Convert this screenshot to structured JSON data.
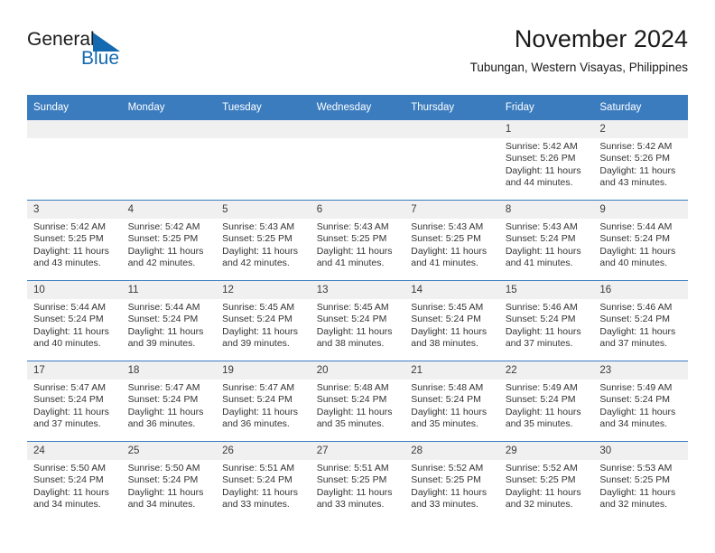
{
  "brand": {
    "name_part1": "General",
    "name_part2": "Blue",
    "triangle_color": "#1569b0"
  },
  "header": {
    "month_title": "November 2024",
    "location": "Tubungan, Western Visayas, Philippines"
  },
  "theme": {
    "header_blue": "#3b7cbf",
    "daynum_band": "#f0f0f0",
    "text": "#333333"
  },
  "columns": [
    "Sunday",
    "Monday",
    "Tuesday",
    "Wednesday",
    "Thursday",
    "Friday",
    "Saturday"
  ],
  "labels": {
    "sunrise_prefix": "Sunrise:",
    "sunset_prefix": "Sunset:",
    "daylight_prefix": "Daylight:"
  },
  "weeks": [
    [
      {
        "day": "",
        "empty": true
      },
      {
        "day": "",
        "empty": true
      },
      {
        "day": "",
        "empty": true
      },
      {
        "day": "",
        "empty": true
      },
      {
        "day": "",
        "empty": true
      },
      {
        "day": "1",
        "sunrise": "Sunrise: 5:42 AM",
        "sunset": "Sunset: 5:26 PM",
        "daylight": "Daylight: 11 hours and 44 minutes."
      },
      {
        "day": "2",
        "sunrise": "Sunrise: 5:42 AM",
        "sunset": "Sunset: 5:26 PM",
        "daylight": "Daylight: 11 hours and 43 minutes."
      }
    ],
    [
      {
        "day": "3",
        "sunrise": "Sunrise: 5:42 AM",
        "sunset": "Sunset: 5:25 PM",
        "daylight": "Daylight: 11 hours and 43 minutes."
      },
      {
        "day": "4",
        "sunrise": "Sunrise: 5:42 AM",
        "sunset": "Sunset: 5:25 PM",
        "daylight": "Daylight: 11 hours and 42 minutes."
      },
      {
        "day": "5",
        "sunrise": "Sunrise: 5:43 AM",
        "sunset": "Sunset: 5:25 PM",
        "daylight": "Daylight: 11 hours and 42 minutes."
      },
      {
        "day": "6",
        "sunrise": "Sunrise: 5:43 AM",
        "sunset": "Sunset: 5:25 PM",
        "daylight": "Daylight: 11 hours and 41 minutes."
      },
      {
        "day": "7",
        "sunrise": "Sunrise: 5:43 AM",
        "sunset": "Sunset: 5:25 PM",
        "daylight": "Daylight: 11 hours and 41 minutes."
      },
      {
        "day": "8",
        "sunrise": "Sunrise: 5:43 AM",
        "sunset": "Sunset: 5:24 PM",
        "daylight": "Daylight: 11 hours and 41 minutes."
      },
      {
        "day": "9",
        "sunrise": "Sunrise: 5:44 AM",
        "sunset": "Sunset: 5:24 PM",
        "daylight": "Daylight: 11 hours and 40 minutes."
      }
    ],
    [
      {
        "day": "10",
        "sunrise": "Sunrise: 5:44 AM",
        "sunset": "Sunset: 5:24 PM",
        "daylight": "Daylight: 11 hours and 40 minutes."
      },
      {
        "day": "11",
        "sunrise": "Sunrise: 5:44 AM",
        "sunset": "Sunset: 5:24 PM",
        "daylight": "Daylight: 11 hours and 39 minutes."
      },
      {
        "day": "12",
        "sunrise": "Sunrise: 5:45 AM",
        "sunset": "Sunset: 5:24 PM",
        "daylight": "Daylight: 11 hours and 39 minutes."
      },
      {
        "day": "13",
        "sunrise": "Sunrise: 5:45 AM",
        "sunset": "Sunset: 5:24 PM",
        "daylight": "Daylight: 11 hours and 38 minutes."
      },
      {
        "day": "14",
        "sunrise": "Sunrise: 5:45 AM",
        "sunset": "Sunset: 5:24 PM",
        "daylight": "Daylight: 11 hours and 38 minutes."
      },
      {
        "day": "15",
        "sunrise": "Sunrise: 5:46 AM",
        "sunset": "Sunset: 5:24 PM",
        "daylight": "Daylight: 11 hours and 37 minutes."
      },
      {
        "day": "16",
        "sunrise": "Sunrise: 5:46 AM",
        "sunset": "Sunset: 5:24 PM",
        "daylight": "Daylight: 11 hours and 37 minutes."
      }
    ],
    [
      {
        "day": "17",
        "sunrise": "Sunrise: 5:47 AM",
        "sunset": "Sunset: 5:24 PM",
        "daylight": "Daylight: 11 hours and 37 minutes."
      },
      {
        "day": "18",
        "sunrise": "Sunrise: 5:47 AM",
        "sunset": "Sunset: 5:24 PM",
        "daylight": "Daylight: 11 hours and 36 minutes."
      },
      {
        "day": "19",
        "sunrise": "Sunrise: 5:47 AM",
        "sunset": "Sunset: 5:24 PM",
        "daylight": "Daylight: 11 hours and 36 minutes."
      },
      {
        "day": "20",
        "sunrise": "Sunrise: 5:48 AM",
        "sunset": "Sunset: 5:24 PM",
        "daylight": "Daylight: 11 hours and 35 minutes."
      },
      {
        "day": "21",
        "sunrise": "Sunrise: 5:48 AM",
        "sunset": "Sunset: 5:24 PM",
        "daylight": "Daylight: 11 hours and 35 minutes."
      },
      {
        "day": "22",
        "sunrise": "Sunrise: 5:49 AM",
        "sunset": "Sunset: 5:24 PM",
        "daylight": "Daylight: 11 hours and 35 minutes."
      },
      {
        "day": "23",
        "sunrise": "Sunrise: 5:49 AM",
        "sunset": "Sunset: 5:24 PM",
        "daylight": "Daylight: 11 hours and 34 minutes."
      }
    ],
    [
      {
        "day": "24",
        "sunrise": "Sunrise: 5:50 AM",
        "sunset": "Sunset: 5:24 PM",
        "daylight": "Daylight: 11 hours and 34 minutes."
      },
      {
        "day": "25",
        "sunrise": "Sunrise: 5:50 AM",
        "sunset": "Sunset: 5:24 PM",
        "daylight": "Daylight: 11 hours and 34 minutes."
      },
      {
        "day": "26",
        "sunrise": "Sunrise: 5:51 AM",
        "sunset": "Sunset: 5:24 PM",
        "daylight": "Daylight: 11 hours and 33 minutes."
      },
      {
        "day": "27",
        "sunrise": "Sunrise: 5:51 AM",
        "sunset": "Sunset: 5:25 PM",
        "daylight": "Daylight: 11 hours and 33 minutes."
      },
      {
        "day": "28",
        "sunrise": "Sunrise: 5:52 AM",
        "sunset": "Sunset: 5:25 PM",
        "daylight": "Daylight: 11 hours and 33 minutes."
      },
      {
        "day": "29",
        "sunrise": "Sunrise: 5:52 AM",
        "sunset": "Sunset: 5:25 PM",
        "daylight": "Daylight: 11 hours and 32 minutes."
      },
      {
        "day": "30",
        "sunrise": "Sunrise: 5:53 AM",
        "sunset": "Sunset: 5:25 PM",
        "daylight": "Daylight: 11 hours and 32 minutes."
      }
    ]
  ]
}
